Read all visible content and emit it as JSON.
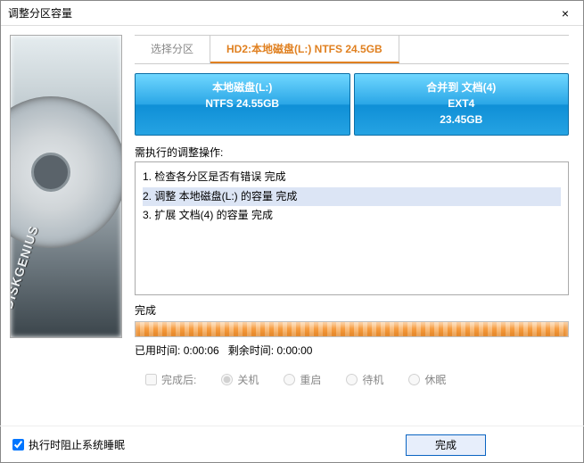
{
  "window": {
    "title": "调整分区容量"
  },
  "sidebar": {
    "brand": "DISKGENIUS"
  },
  "tabs": {
    "select": "选择分区",
    "active": "HD2:本地磁盘(L:) NTFS 24.5GB"
  },
  "partitions": [
    {
      "name": "本地磁盘(L:)",
      "fs": "NTFS 24.55GB"
    },
    {
      "name": "合并到 文档(4)",
      "fs": "EXT4",
      "size": "23.45GB"
    }
  ],
  "ops": {
    "label": "需执行的调整操作:",
    "items": [
      "1. 检查各分区是否有错误    完成",
      "2. 调整 本地磁盘(L:) 的容量    完成",
      "3. 扩展 文档(4) 的容量    完成"
    ],
    "selected": 1
  },
  "status": "完成",
  "time": {
    "elapsed_label": "已用时间:",
    "elapsed": "0:00:06",
    "remain_label": "剩余时间:",
    "remain": "0:00:00"
  },
  "post": {
    "after_label": "完成后:",
    "options": [
      "关机",
      "重启",
      "待机",
      "休眠"
    ],
    "selected": 0
  },
  "bottom": {
    "prevent_sleep": "执行时阻止系统睡眠",
    "done": "完成"
  }
}
